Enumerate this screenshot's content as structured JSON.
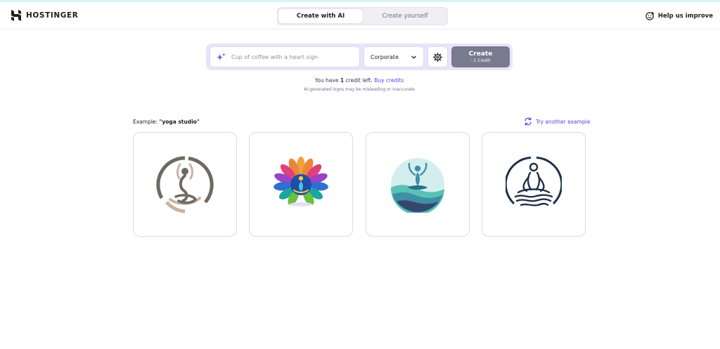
{
  "brand": {
    "name": "HOSTINGER",
    "logo_icon": "hostinger-logo"
  },
  "mode_tabs": [
    {
      "label": "Create with AI",
      "active": true
    },
    {
      "label": "Create yourself",
      "active": false
    }
  ],
  "help": {
    "label": "Help us improve",
    "icon": "smiley-edit-icon"
  },
  "prompt": {
    "value": "",
    "placeholder": "Cup of coffee with a heart sign",
    "icon": "sparkle-icon"
  },
  "style_select": {
    "selected": "Corporate",
    "icon": "chevron-down-icon"
  },
  "settings": {
    "icon": "gear-icon"
  },
  "create_button": {
    "label": "Create",
    "sublabel": "- 1 Credit"
  },
  "credits": {
    "prefix": "You have ",
    "count": "1",
    "suffix": " credit left.",
    "buy_link": "Buy credits"
  },
  "disclaimer": "AI-generated logos may be misleading or inaccurate",
  "example": {
    "prefix": "Example: ",
    "term": "\"yoga studio\"",
    "try_another": "Try another example",
    "try_icon": "refresh-icon"
  },
  "example_logos": [
    {
      "name": "yoga-pose-earth-tone-logo"
    },
    {
      "name": "colorful-lotus-yoga-logo"
    },
    {
      "name": "teal-meditation-circle-logo"
    },
    {
      "name": "navy-line-meditation-logo"
    }
  ],
  "colors": {
    "accent": "#673de6",
    "create_button": "#787a8e",
    "prompt_bar_bg": "#e8e4fb"
  }
}
